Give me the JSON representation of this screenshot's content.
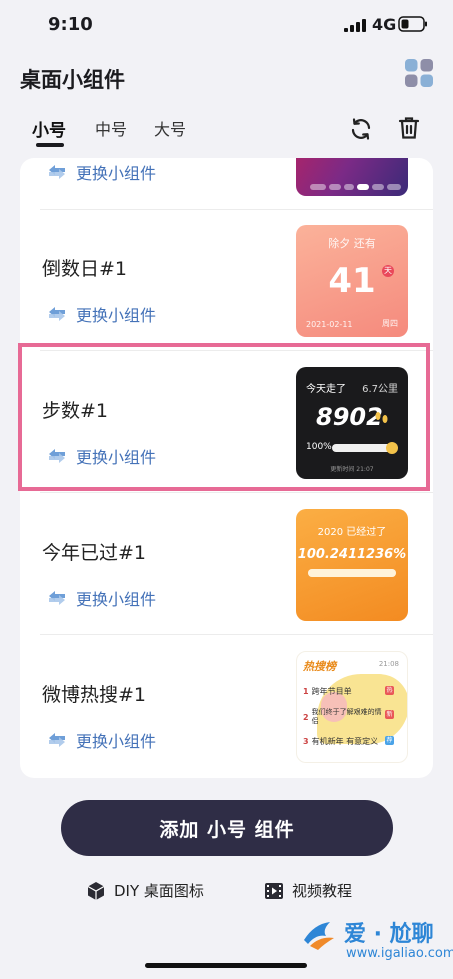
{
  "status": {
    "time": "9:10",
    "network": "4G"
  },
  "header": {
    "title": "桌面小组件"
  },
  "tabs": [
    {
      "label": "小号"
    },
    {
      "label": "中号"
    },
    {
      "label": "大号"
    }
  ],
  "swap_label": "更换小组件",
  "widgets": [
    {
      "name": "倒数日#1",
      "preview": {
        "title": "除夕 还有",
        "value": "41",
        "tag": "天",
        "date": "2021-02-11",
        "weekday": "周四"
      }
    },
    {
      "name": "步数#1",
      "preview": {
        "title": "今天走了",
        "distance": "6.7公里",
        "value": "8902",
        "percent": "100%",
        "percent_value": 100,
        "foot": "更新时间 21:07"
      }
    },
    {
      "name": "今年已过#1",
      "preview": {
        "title": "2020 已经过了",
        "value": "100.2411236%",
        "percent_value": 100
      }
    },
    {
      "name": "微博热搜#1",
      "preview": {
        "title": "热搜榜",
        "time": "21:08",
        "items": [
          {
            "rank": "1",
            "text": "跨年节目单",
            "badge": "热"
          },
          {
            "rank": "2",
            "text": "我们终于了解艰难的情侣",
            "badge": "新"
          },
          {
            "rank": "3",
            "text": "有机新年 有意定义",
            "badge": "荐"
          }
        ]
      }
    }
  ],
  "bottom": {
    "add_button": "添加 小号 组件",
    "diy_link": "DIY 桌面图标",
    "video_link": "视频教程"
  },
  "watermark": {
    "brand": "爱 · 尬聊",
    "url": "www.igaliao.com"
  },
  "colors": {
    "accent": "#2f2d46",
    "link": "#4472b8",
    "highlight": "#e76a95"
  }
}
